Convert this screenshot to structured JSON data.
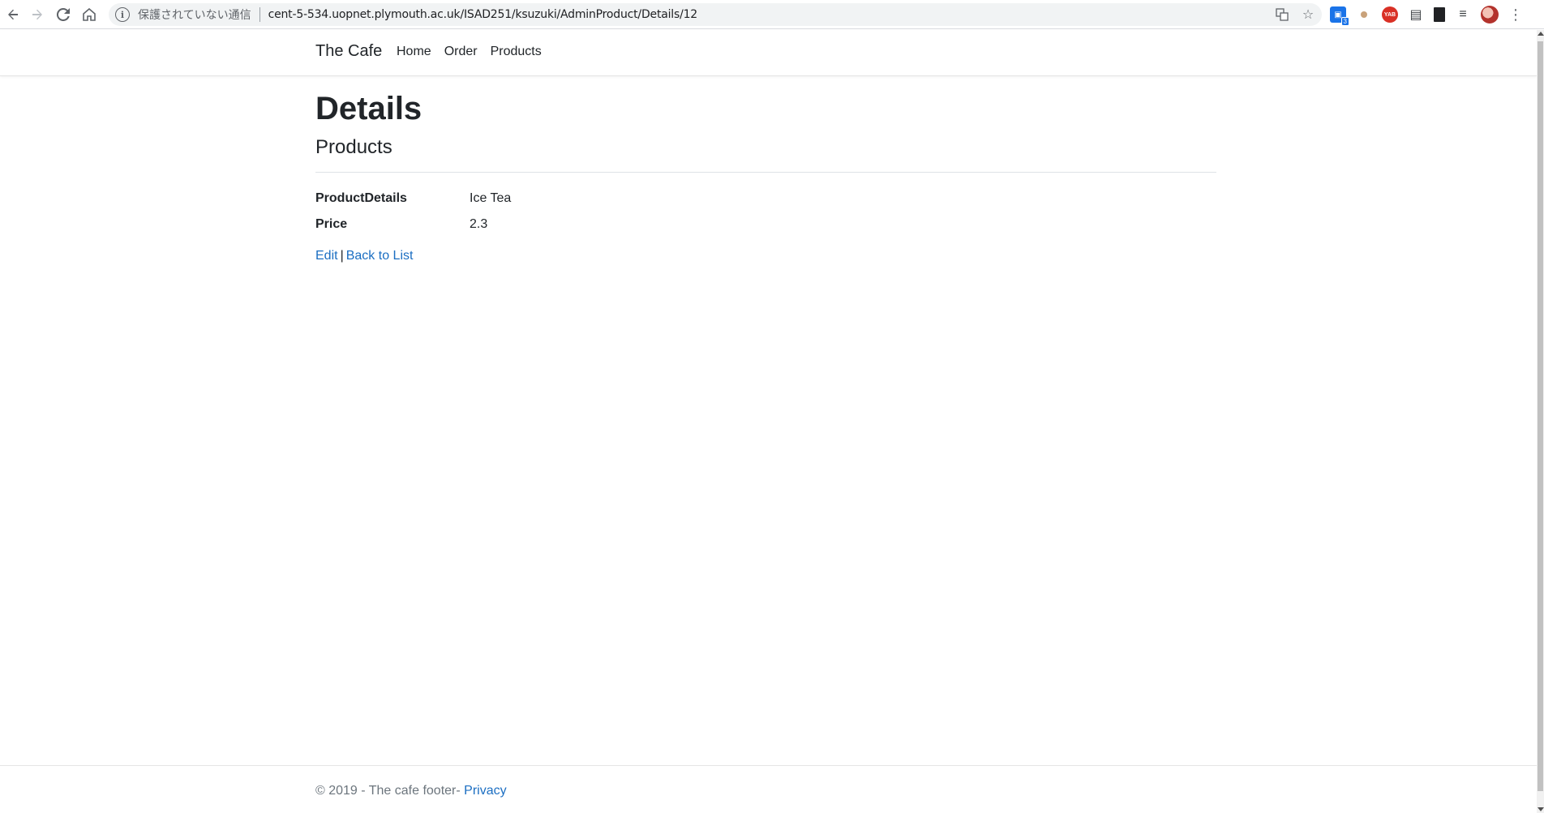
{
  "browser": {
    "back_icon": "arrow-left-icon",
    "forward_icon": "arrow-right-icon",
    "reload_icon": "reload-icon",
    "home_icon": "home-icon",
    "security_status": "保護されていない通信",
    "url": "cent-5-534.uopnet.plymouth.ac.uk/ISAD251/ksuzuki/AdminProduct/Details/12",
    "extension_badge": "3",
    "red_extension_text": "YAB"
  },
  "header": {
    "brand": "The Cafe",
    "nav": [
      {
        "label": "Home"
      },
      {
        "label": "Order"
      },
      {
        "label": "Products"
      }
    ]
  },
  "main": {
    "title": "Details",
    "subtitle": "Products",
    "fields": [
      {
        "label": "ProductDetails",
        "value": "Ice Tea"
      },
      {
        "label": "Price",
        "value": "2.3"
      }
    ],
    "edit_link": "Edit",
    "separator": "|",
    "back_link": "Back to List"
  },
  "footer": {
    "text": "© 2019 - The cafe footer-",
    "privacy_link": "Privacy"
  },
  "colors": {
    "link": "#1b6ec2",
    "text": "#212529",
    "muted": "#6c757d"
  }
}
